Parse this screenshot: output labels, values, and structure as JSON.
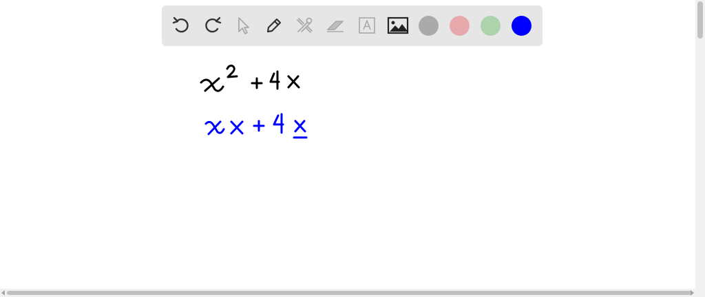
{
  "toolbar": {
    "tools": [
      {
        "icon": "undo-icon"
      },
      {
        "icon": "redo-icon"
      },
      {
        "icon": "select-arrow-icon"
      },
      {
        "icon": "pencil-icon"
      },
      {
        "icon": "tools-icon"
      },
      {
        "icon": "eraser-icon"
      },
      {
        "icon": "text-box-icon"
      },
      {
        "icon": "image-icon"
      }
    ],
    "colors": [
      {
        "name": "gray",
        "hex": "#aaaaaa"
      },
      {
        "name": "pink",
        "hex": "#e8a9ad"
      },
      {
        "name": "green",
        "hex": "#acd3ac"
      },
      {
        "name": "blue",
        "hex": "#0000ff"
      }
    ],
    "selected_color": "blue"
  },
  "canvas": {
    "lines": [
      {
        "text": "x² + 4x",
        "color": "#000000"
      },
      {
        "text": "xx + 4x",
        "color": "#0000ff"
      }
    ]
  }
}
